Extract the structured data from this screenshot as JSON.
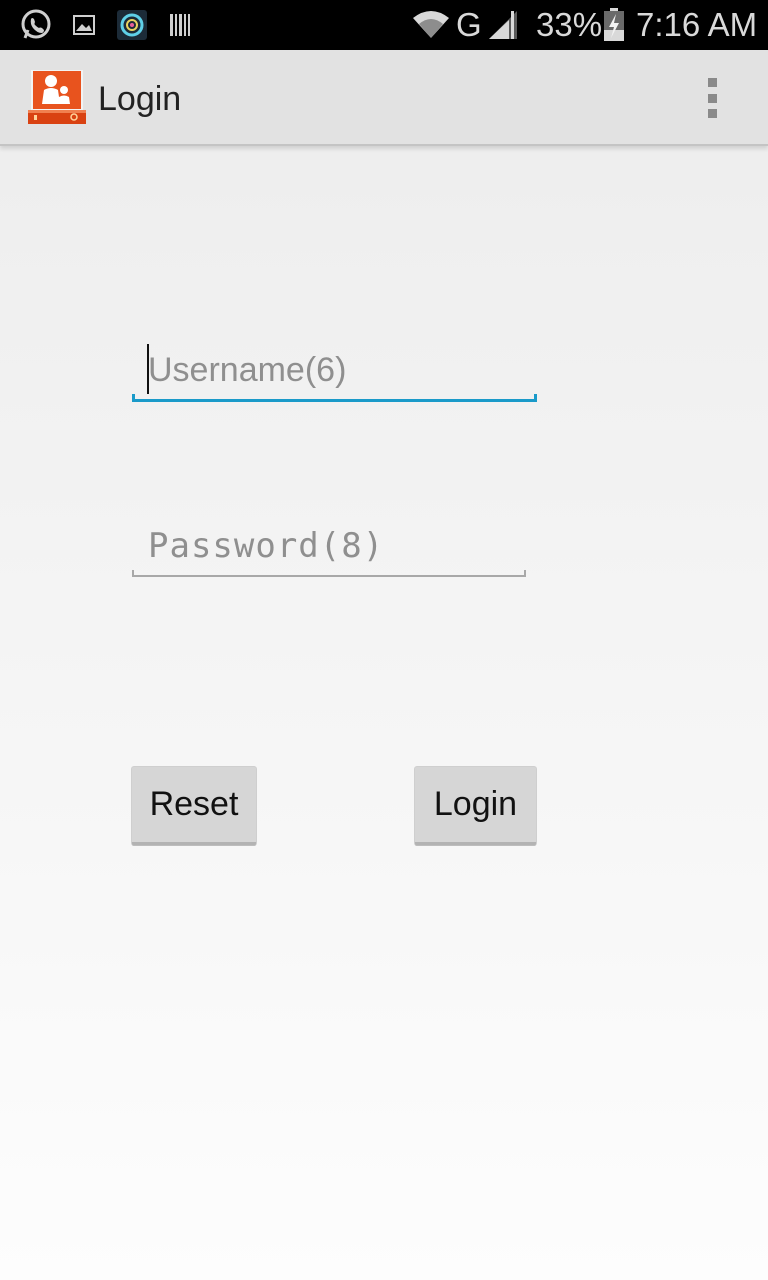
{
  "status_bar": {
    "network": "G",
    "battery": "33%",
    "time": "7:16 AM",
    "icons": [
      "whatsapp-icon",
      "image-icon",
      "camera-app-icon",
      "barcode-icon",
      "wifi-icon",
      "signal-icon",
      "battery-charging-icon"
    ]
  },
  "action_bar": {
    "title": "Login",
    "app_icon": "parental-control-app-icon",
    "menu_icon": "overflow-menu-icon"
  },
  "form": {
    "username": {
      "placeholder": "Username(6)",
      "value": ""
    },
    "password": {
      "placeholder": "Password(8)",
      "value": ""
    },
    "reset_label": "Reset",
    "login_label": "Login"
  },
  "colors": {
    "accent": "#1a9ac9",
    "underline_inactive": "#a8a8a8",
    "action_bar": "#e2e2e2",
    "status_bar": "#000000",
    "app_icon_orange": "#e8531e"
  }
}
